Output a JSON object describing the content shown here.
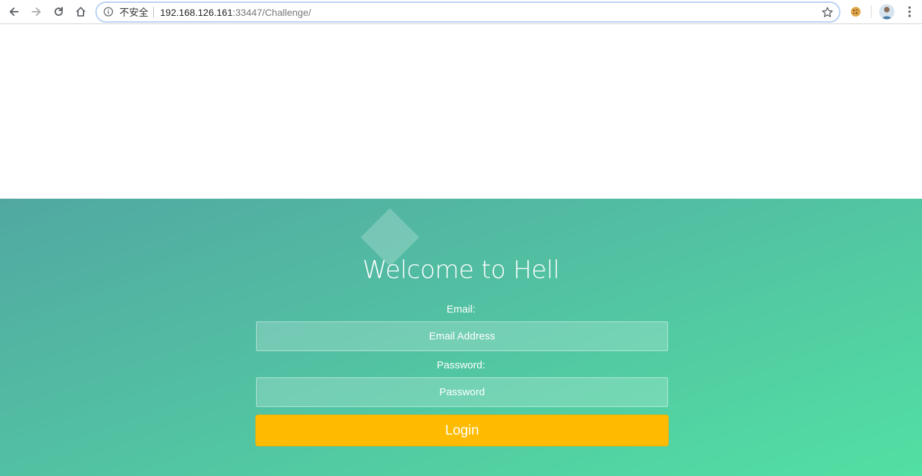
{
  "browser": {
    "security_label": "不安全",
    "url_host": "192.168.126.161",
    "url_rest": ":33447/Challenge/",
    "icons": {
      "back": "back-arrow-icon",
      "forward": "forward-arrow-icon",
      "reload": "reload-icon",
      "home": "home-icon",
      "info": "info-icon",
      "bookmark": "star-icon",
      "extension": "cookie-icon",
      "profile": "avatar-icon",
      "menu": "kebab-menu-icon"
    }
  },
  "login": {
    "title": "Welcome to Hell",
    "email_label": "Email:",
    "email_placeholder": "Email Address",
    "email_value": "",
    "password_label": "Password:",
    "password_placeholder": "Password",
    "password_value": "",
    "button_label": "Login"
  },
  "colors": {
    "gradient_start": "#51a8a2",
    "gradient_end": "#52e0a3",
    "button": "#ffbb00",
    "text": "#ffffff"
  }
}
